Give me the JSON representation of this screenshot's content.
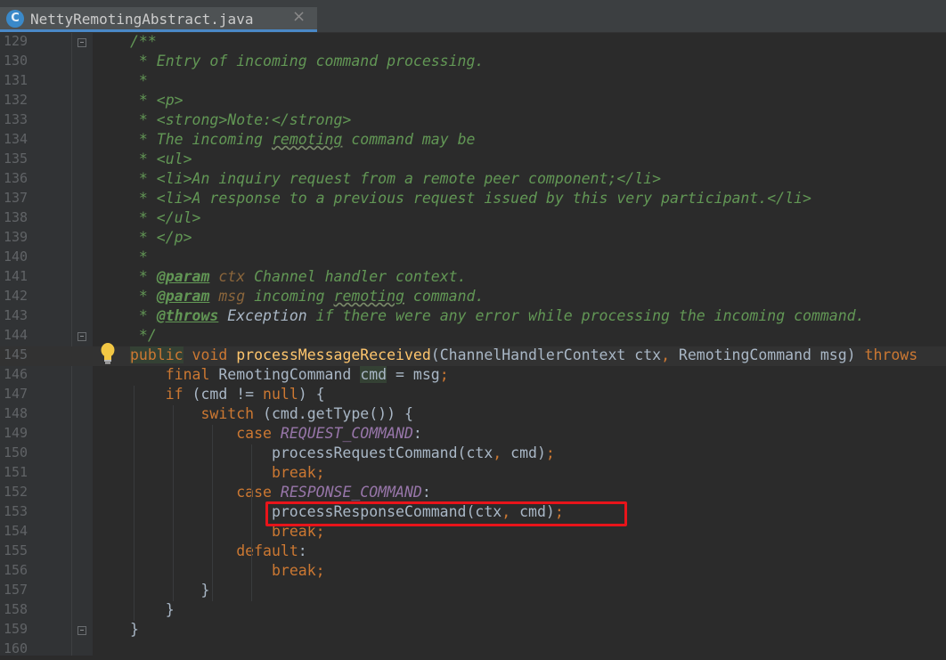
{
  "tab": {
    "filename": "NettyRemotingAbstract.java",
    "icon_letter": "C",
    "close": "×"
  },
  "lines": [
    {
      "n": "129",
      "html": "<span class=\"doc\">/**</span>"
    },
    {
      "n": "130",
      "html": "<span class=\"doc\"> * Entry of incoming command processing.</span>"
    },
    {
      "n": "131",
      "html": "<span class=\"doc\"> *</span>"
    },
    {
      "n": "132",
      "html": "<span class=\"doc\"> * &lt;p&gt;</span>"
    },
    {
      "n": "133",
      "html": "<span class=\"doc\"> * &lt;strong&gt;Note:&lt;/strong&gt;</span>"
    },
    {
      "n": "134",
      "html": "<span class=\"doc\"> * The incoming <span class=\"squig\">remoting</span> command may be</span>"
    },
    {
      "n": "135",
      "html": "<span class=\"doc\"> * &lt;ul&gt;</span>"
    },
    {
      "n": "136",
      "html": "<span class=\"doc\"> * &lt;li&gt;An inquiry request from a remote peer component;&lt;/li&gt;</span>"
    },
    {
      "n": "137",
      "html": "<span class=\"doc\"> * &lt;li&gt;A response to a previous request issued by this very participant.&lt;/li&gt;</span>"
    },
    {
      "n": "138",
      "html": "<span class=\"doc\"> * &lt;/ul&gt;</span>"
    },
    {
      "n": "139",
      "html": "<span class=\"doc\"> * &lt;/p&gt;</span>"
    },
    {
      "n": "140",
      "html": "<span class=\"doc\"> *</span>"
    },
    {
      "n": "141",
      "html": "<span class=\"doc\"> * </span><span class=\"doctag\">@param</span><span class=\"param\"> ctx</span><span class=\"doc\"> Channel handler context.</span>"
    },
    {
      "n": "142",
      "html": "<span class=\"doc\"> * </span><span class=\"doctag\">@param</span><span class=\"param\"> msg</span><span class=\"doc\"> incoming <span class=\"squig\">remoting</span> command.</span>"
    },
    {
      "n": "143",
      "html": "<span class=\"doc\"> * </span><span class=\"doctag\">@throws</span><span class=\"exc\"> Exception</span><span class=\"doc\"> if there were any error while processing the incoming command.</span>"
    },
    {
      "n": "144",
      "html": "<span class=\"doc\"> */</span>"
    },
    {
      "n": "145",
      "current": true,
      "html": "<span class=\"kw hl\">public</span> <span class=\"kw\">void</span> <span class=\"method\">processMessageReceived</span>(ChannelHandlerContext ctx<span class=\"kw\">,</span> RemotingCommand msg) <span class=\"kw\">throws</span>"
    },
    {
      "n": "146",
      "html": "    <span class=\"kw\">final</span> RemotingCommand <span class=\"hl\">cmd</span> = msg<span class=\"kw\">;</span>"
    },
    {
      "n": "147",
      "html": "    <span class=\"kw\">if</span> (cmd != <span class=\"kw\">null</span>) {"
    },
    {
      "n": "148",
      "html": "        <span class=\"kw\">switch</span> (cmd.getType()) {"
    },
    {
      "n": "149",
      "html": "            <span class=\"kw\">case</span> <span class=\"const\">REQUEST_COMMAND</span>:"
    },
    {
      "n": "150",
      "html": "                processRequestCommand(ctx<span class=\"kw\">,</span> cmd)<span class=\"kw\">;</span>"
    },
    {
      "n": "151",
      "html": "                <span class=\"kw\">break;</span>"
    },
    {
      "n": "152",
      "html": "            <span class=\"kw\">case</span> <span class=\"const\">RESPONSE_COMMAND</span>:"
    },
    {
      "n": "153",
      "html": "                processResponseCommand(ctx<span class=\"kw\">,</span> cmd)<span class=\"kw\">;</span>"
    },
    {
      "n": "154",
      "html": "                <span class=\"kw\">break;</span>"
    },
    {
      "n": "155",
      "html": "            <span class=\"kw\">default</span>:"
    },
    {
      "n": "156",
      "html": "                <span class=\"kw\">break;</span>"
    },
    {
      "n": "157",
      "html": "        }"
    },
    {
      "n": "158",
      "html": "    }"
    },
    {
      "n": "159",
      "html": "}"
    },
    {
      "n": "160",
      "html": ""
    }
  ],
  "colors": {
    "background": "#2b2b2b",
    "keyword": "#cc7832",
    "method": "#ffc66d",
    "javadoc": "#629755",
    "constant": "#9876aa",
    "highlight_box": "#e8141a"
  },
  "icons": {
    "intention": "lightbulb-icon",
    "fold": "fold-marker-icon"
  }
}
